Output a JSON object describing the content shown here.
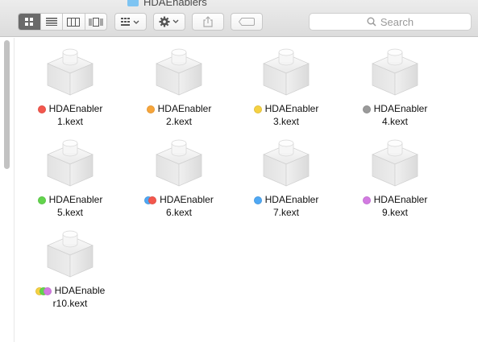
{
  "window": {
    "title": "HDAEnablers"
  },
  "toolbar": {
    "view_modes": [
      "icon-view",
      "list-view",
      "column-view",
      "cover-flow-view"
    ],
    "active_view": "icon-view",
    "search_placeholder": "Search"
  },
  "colors": {
    "red": "#f3574d",
    "orange": "#f7a53a",
    "yellow": "#f5d142",
    "gray": "#9a9a9a",
    "green": "#62d44c",
    "blue": "#4fa8f4",
    "purple": "#d37be2"
  },
  "files": [
    {
      "name": "HDAEnabler1.kext",
      "tags": [
        "#f3574d"
      ]
    },
    {
      "name": "HDAEnabler2.kext",
      "tags": [
        "#f7a53a"
      ]
    },
    {
      "name": "HDAEnabler3.kext",
      "tags": [
        "#f5d142"
      ]
    },
    {
      "name": "HDAEnabler4.kext",
      "tags": [
        "#9a9a9a"
      ]
    },
    {
      "name": "HDAEnabler5.kext",
      "tags": [
        "#62d44c"
      ]
    },
    {
      "name": "HDAEnabler6.kext",
      "tags": [
        "#4fa8f4",
        "#f3574d"
      ]
    },
    {
      "name": "HDAEnabler7.kext",
      "tags": [
        "#4fa8f4"
      ]
    },
    {
      "name": "HDAEnabler9.kext",
      "tags": [
        "#d37be2"
      ]
    },
    {
      "name": "HDAEnabler10.kext",
      "tags": [
        "#f5d142",
        "#62d44c",
        "#d37be2"
      ]
    }
  ]
}
